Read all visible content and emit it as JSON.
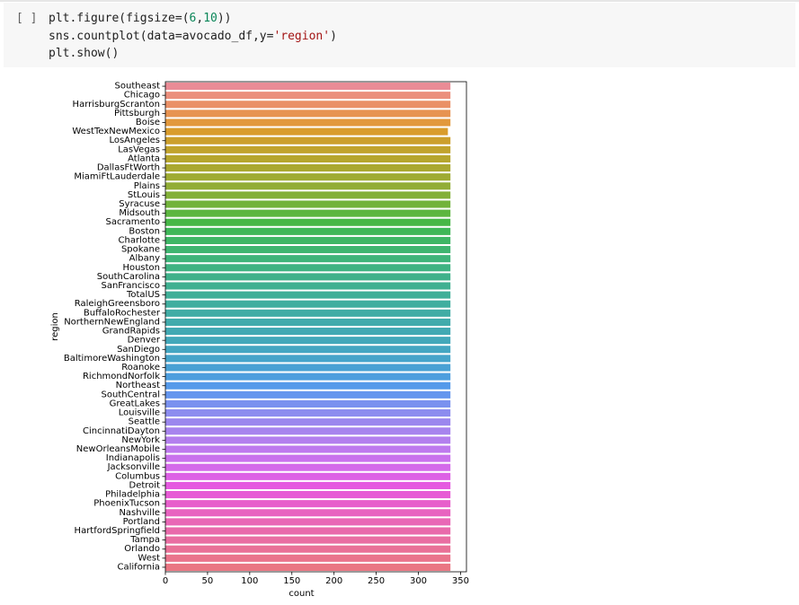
{
  "cell": {
    "run_indicator": "[ ]",
    "code_lines": [
      [
        {
          "t": "plt.figure(figsize=("
        },
        {
          "t": "6",
          "c": "num"
        },
        {
          "t": ","
        },
        {
          "t": "10",
          "c": "num"
        },
        {
          "t": "))"
        }
      ],
      [
        {
          "t": "sns.countplot(data=avocado_df,y="
        },
        {
          "t": "'region'",
          "c": "str"
        },
        {
          "t": ")"
        }
      ],
      [
        {
          "t": "plt.show()"
        }
      ]
    ]
  },
  "chart_data": {
    "type": "bar",
    "orientation": "horizontal",
    "title": "",
    "xlabel": "count",
    "ylabel": "region",
    "xlim": [
      0,
      357
    ],
    "xticks": [
      0,
      50,
      100,
      150,
      200,
      250,
      300,
      350
    ],
    "grid": false,
    "categories": [
      "Southeast",
      "Chicago",
      "HarrisburgScranton",
      "Pittsburgh",
      "Boise",
      "WestTexNewMexico",
      "LosAngeles",
      "LasVegas",
      "Atlanta",
      "DallasFtWorth",
      "MiamiFtLauderdale",
      "Plains",
      "StLouis",
      "Syracuse",
      "Midsouth",
      "Sacramento",
      "Boston",
      "Charlotte",
      "Spokane",
      "Albany",
      "Houston",
      "SouthCarolina",
      "SanFrancisco",
      "TotalUS",
      "RaleighGreensboro",
      "BuffaloRochester",
      "NorthernNewEngland",
      "GrandRapids",
      "Denver",
      "SanDiego",
      "BaltimoreWashington",
      "Roanoke",
      "RichmondNorfolk",
      "Northeast",
      "SouthCentral",
      "GreatLakes",
      "Louisville",
      "Seattle",
      "CincinnatiDayton",
      "NewYork",
      "NewOrleansMobile",
      "Indianapolis",
      "Jacksonville",
      "Columbus",
      "Detroit",
      "Philadelphia",
      "PhoenixTucson",
      "Nashville",
      "Portland",
      "HartfordSpringfield",
      "Tampa",
      "Orlando",
      "West",
      "California"
    ],
    "values": [
      338,
      338,
      338,
      338,
      338,
      335,
      338,
      338,
      338,
      338,
      338,
      338,
      338,
      338,
      338,
      338,
      338,
      338,
      338,
      338,
      338,
      338,
      338,
      338,
      338,
      338,
      338,
      338,
      338,
      338,
      338,
      338,
      338,
      338,
      338,
      338,
      338,
      338,
      338,
      338,
      338,
      338,
      338,
      338,
      338,
      338,
      338,
      338,
      338,
      338,
      338,
      338,
      338,
      338
    ],
    "colors": [
      "#ea8c96",
      "#eb8f7d",
      "#ea9066",
      "#e79351",
      "#e2983c",
      "#d99c2c",
      "#cc9f2c",
      "#c1a32d",
      "#b6a62e",
      "#aaa831",
      "#9fab33",
      "#92ad36",
      "#83b038",
      "#72b33b",
      "#5cb63f",
      "#46b746",
      "#3eb757",
      "#3eb665",
      "#3fb570",
      "#3fb47a",
      "#3fb382",
      "#3fb18a",
      "#3fb091",
      "#40af98",
      "#40ae9f",
      "#41aca5",
      "#41abac",
      "#42a9b3",
      "#43a8ba",
      "#44a6c2",
      "#46a4ca",
      "#49a1d4",
      "#4d9ede",
      "#559aea",
      "#6596ee",
      "#7a91ef",
      "#8c8cef",
      "#9b87ee",
      "#a784ee",
      "#b37fee",
      "#be79ee",
      "#c972ed",
      "#d46aea",
      "#dd61e5",
      "#e55ae0",
      "#e75bd5",
      "#e75fcb",
      "#e863c0",
      "#e967b6",
      "#e96aab",
      "#e96ea2",
      "#e97197",
      "#ea748c",
      "#ea7683"
    ]
  }
}
